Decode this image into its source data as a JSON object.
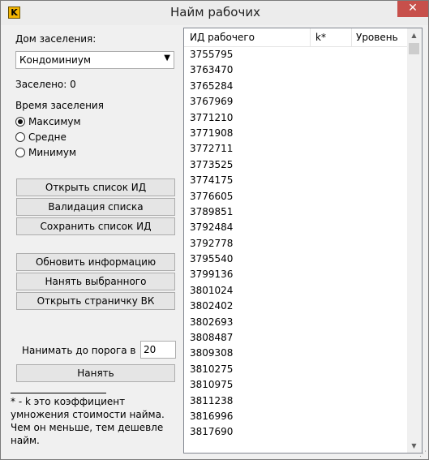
{
  "window": {
    "title": "Найм рабочих",
    "icon_letter": "K",
    "close": "✕"
  },
  "left": {
    "house_label": "Дом заселения:",
    "house_selected": "Кондоминиум",
    "settled_label": "Заселено:",
    "settled_count": "0",
    "time_label": "Время заселения",
    "time_options": [
      {
        "label": "Максимум",
        "checked": true
      },
      {
        "label": "Средне",
        "checked": false
      },
      {
        "label": "Минимум",
        "checked": false
      }
    ],
    "buttons_group1": [
      "Открыть список ИД",
      "Валидация списка",
      "Сохранить список ИД"
    ],
    "buttons_group2": [
      "Обновить информацию",
      "Нанять выбранного",
      "Открыть страничку ВК"
    ],
    "hire_threshold_label": "Нанимать до порога в",
    "hire_threshold_value": "20",
    "hire_button": "Нанять",
    "footnote": "* - k это коэффициент умножения стоимости найма. Чем он меньше, тем дешевле найм."
  },
  "list": {
    "columns": [
      "ИД рабочего",
      "k*",
      "Уровень"
    ],
    "rows": [
      "3755795",
      "3763470",
      "3765284",
      "3767969",
      "3771210",
      "3771908",
      "3772711",
      "3773525",
      "3774175",
      "3776605",
      "3789851",
      "3792484",
      "3792778",
      "3795540",
      "3799136",
      "3801024",
      "3802402",
      "3802693",
      "3808487",
      "3809308",
      "3810275",
      "3810975",
      "3811238",
      "3816996",
      "3817690"
    ]
  }
}
